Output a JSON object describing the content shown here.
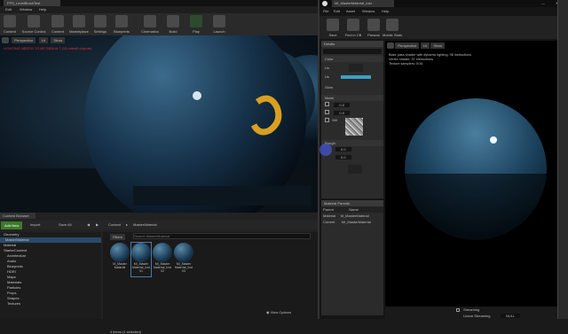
{
  "main": {
    "title": "FPS_LevelBrushTest",
    "menu": [
      "Edit",
      "Window",
      "Help"
    ],
    "toolbar": [
      {
        "label": "Content",
        "icon": "content-icon"
      },
      {
        "label": "Source Control",
        "icon": "source-control-icon"
      },
      {
        "label": "Content",
        "icon": "folder-icon"
      },
      {
        "label": "Marketplace",
        "icon": "marketplace-icon"
      },
      {
        "label": "Settings",
        "icon": "gear-icon"
      },
      {
        "label": "Blueprints",
        "icon": "blueprint-icon"
      },
      {
        "label": "Cinematics",
        "icon": "cinematics-icon"
      },
      {
        "label": "Build",
        "icon": "build-icon"
      },
      {
        "label": "Play",
        "icon": "play-icon"
      },
      {
        "label": "Launch",
        "icon": "launch-icon"
      }
    ],
    "viewport": {
      "mode": "Perspective",
      "lit": "Lit",
      "show": "Show",
      "warning": "LIGHTING NEEDS TO BE REBUILT (13 unbuilt objects)"
    }
  },
  "content_browser": {
    "tab": "Content Browser",
    "add_new": "Add New",
    "import": "Import",
    "save_all": "Save All",
    "path": [
      "Content",
      "MasterMaterial"
    ],
    "filters": "Filters",
    "search_placeholder": "Search MasterMaterial",
    "tree": [
      "Geometry",
      "MasterMaterial",
      "Material",
      "StarterContent",
      "Architecture",
      "Audio",
      "Blueprints",
      "HDRI",
      "Maps",
      "Materials",
      "Particles",
      "Props",
      "Shapes",
      "Textures"
    ],
    "assets": [
      "M_Master Material",
      "MI_Master Material_Inst 01",
      "MI_Master Material_Inst 02",
      "MI_Master Material_Inst 03"
    ],
    "footer": "4 items (1 selected)",
    "view_options": "View Options"
  },
  "material_editor": {
    "title": "MI_MasterMaterial_Inst",
    "menu": [
      "File",
      "Edit",
      "Asset",
      "Window",
      "Help"
    ],
    "toolbar": [
      {
        "label": "Save",
        "icon": "save-icon"
      },
      {
        "label": "Find in CB",
        "icon": "find-icon"
      },
      {
        "label": "Params",
        "icon": "params-icon"
      },
      {
        "label": "Mobile Stats",
        "icon": "stats-icon"
      }
    ],
    "details_tab": "Details",
    "params": [
      "Color",
      "Metal",
      "Rough"
    ],
    "color_rows": [
      "Un",
      "Us",
      "Glow"
    ],
    "metal_rows": [
      "0.0",
      "0.0",
      "Mtl"
    ],
    "rough_rows": [
      "0.0",
      "0.0"
    ],
    "parents_tab": "Material Parents",
    "parents_header": [
      "Parent",
      "Name"
    ],
    "parents_rows": [
      [
        "Material",
        "M_MasterMaterial"
      ],
      [
        "Current",
        "MI_MasterMaterial"
      ]
    ],
    "preview": {
      "mode": "Perspective",
      "lit": "Lit",
      "show": "Show"
    },
    "stats": [
      "Base pass shader with dynamic lighting: 96 instructions",
      "Vertex shader: 37 instructions",
      "Texture samplers: 5/16"
    ],
    "bottom": {
      "label": "Streaming",
      "sub": "Linear Streaming",
      "value": "NULL"
    }
  }
}
